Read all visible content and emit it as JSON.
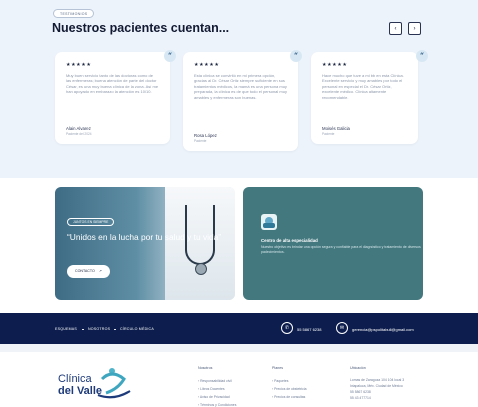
{
  "testimonials": {
    "tag": "TESTIMONIOS",
    "heading": "Nuestros pacientes cuentan...",
    "prev": "‹",
    "next": "›",
    "cards": [
      {
        "stars": "★★★★★",
        "quote_mark": "“",
        "text": "Muy buen servicio tanto de las doctoras como de las enfermeras; buena atención de parte del doctor César, es una muy buena clínica de la zona. Así me han apoyado en embarazo la atención es 10/10.",
        "author": "Alain Alvarez",
        "role": "Paciente del 2024"
      },
      {
        "stars": "★★★★★",
        "quote_mark": "“",
        "text": "Esta clínica se convirtió en mi primera opción, gracias al Dr. César Ortiz siempre suficiente en sus tratamientos médicos, la mamá es una persona muy preparada, la clínica es de que todo el personal muy amables y enfermeras son buenas.",
        "author": "Rosa López",
        "role": "Paciente"
      },
      {
        "stars": "★★★★★",
        "quote_mark": "“",
        "text": "Hace mucho que tuve a mi bb en esta Clínica. Excelente servicio y muy amables por todo el personal en especial el Dr. César Ortiz, excelente médico. Clínica altamente recomendable.",
        "author": "Moisés Galicia",
        "role": "Paciente"
      }
    ]
  },
  "promo": {
    "tag": "JUNTOS EN SIEMPRE",
    "title": "“Unidos en la lucha por tu salud y tu vida”",
    "button": "CONTACTO",
    "button_icon": "↗"
  },
  "specialty": {
    "title": "Centro de alta especialidad",
    "desc": "Nuestro objetivo es brindar una opción segura y confiable para el diagnóstico y tratamiento de diversos padecimientos."
  },
  "bar": {
    "links": [
      "ESQUEMAS",
      "NOSOTROS",
      "CÍRCULO MÉDICA"
    ],
    "phone_icon": "✆",
    "phone": "55 5867 6238",
    "email_icon": "✉",
    "email": "gerencia@pspolitabull@gmail.com"
  },
  "footer": {
    "logo_line1": "Clínica",
    "logo_line2": "del Valle",
    "col1_head": "Nosotros",
    "col1_items": [
      "Responsabilidad civil",
      "Libros Docentes",
      "Aviso de Privacidad",
      "Términos y Condiciones"
    ],
    "col2_head": "Planes",
    "col2_items": [
      "Paquetes",
      "Precios de obstetricia",
      "Precios de consultas"
    ],
    "col3_head": "Ubicación",
    "col3_items": [
      "Lomas de Zaragoza 104 104 local 3",
      "Ixtapaluca, Méx. Ciudad de México",
      "55 5867 6238",
      "55 43 477714"
    ]
  },
  "colors": {
    "navy": "#0d1e4e",
    "teal": "#43787f",
    "page_bg": "#edf3fa"
  }
}
